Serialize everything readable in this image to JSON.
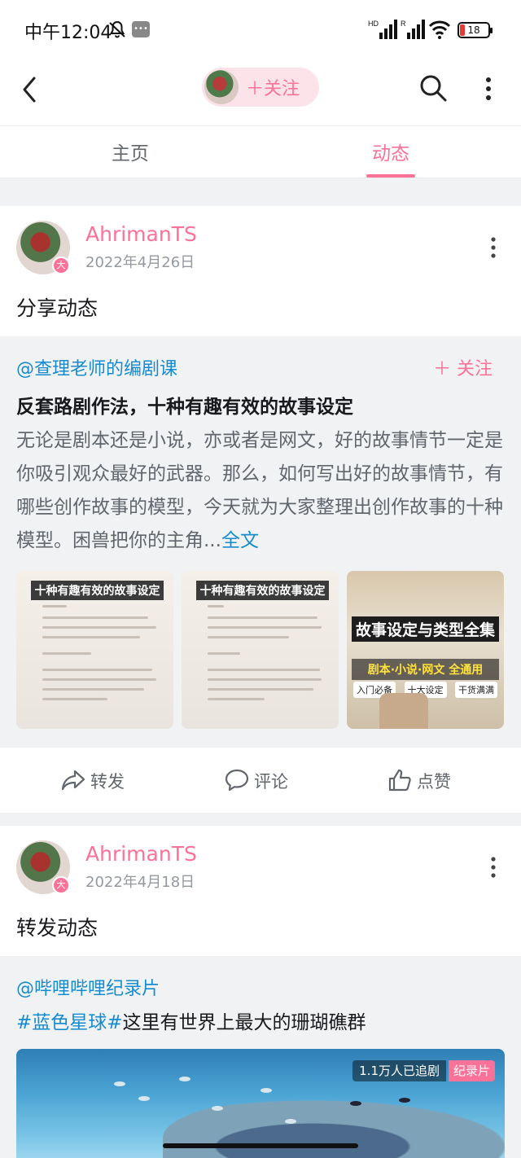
{
  "status_bar": {
    "time": "中午12:04",
    "network_left": "HD",
    "network_right": "R",
    "battery_level": "18",
    "battery_fraction": 0.18
  },
  "header": {
    "follow_label": "＋关注"
  },
  "tabs": [
    {
      "label": "主页",
      "active": false
    },
    {
      "label": "动态",
      "active": true
    }
  ],
  "posts": [
    {
      "username": "AhrimanTS",
      "badge": "大",
      "date": "2022年4月26日",
      "type_label": "分享动态",
      "shared": {
        "source": "@查理老师的编剧课",
        "follow_label": "＋ 关注",
        "title": "反套路剧作法，十种有趣有效的故事设定",
        "body": "无论是剧本还是小说，亦或者是网文，好的故事情节一定是你吸引观众最好的武器。那么，如何写出好的故事情节，有哪些创作故事的模型，今天就为大家整理出创作故事的十种模型。困兽把你的主角...",
        "full_text_link": "全文",
        "images": [
          {
            "heading": "十种有趣有效的故事设定"
          },
          {
            "heading": "十种有趣有效的故事设定"
          },
          {
            "heading": "故事设定与类型全集",
            "subheading": "剧本·小说·网文 全通用",
            "tags": [
              "入门必备",
              "十大设定",
              "干货满满"
            ]
          }
        ]
      },
      "actions": {
        "forward": "转发",
        "comment": "评论",
        "like": "点赞"
      }
    },
    {
      "username": "AhrimanTS",
      "badge": "大",
      "date": "2022年4月18日",
      "type_label": "转发动态",
      "shared": {
        "source": "@哔哩哔哩纪录片",
        "hashtag": "#蓝色星球#",
        "title_rest": "这里有世界上最大的珊瑚礁群",
        "video": {
          "views": "1.1万人已追剧",
          "kind": "纪录片"
        }
      }
    }
  ]
}
